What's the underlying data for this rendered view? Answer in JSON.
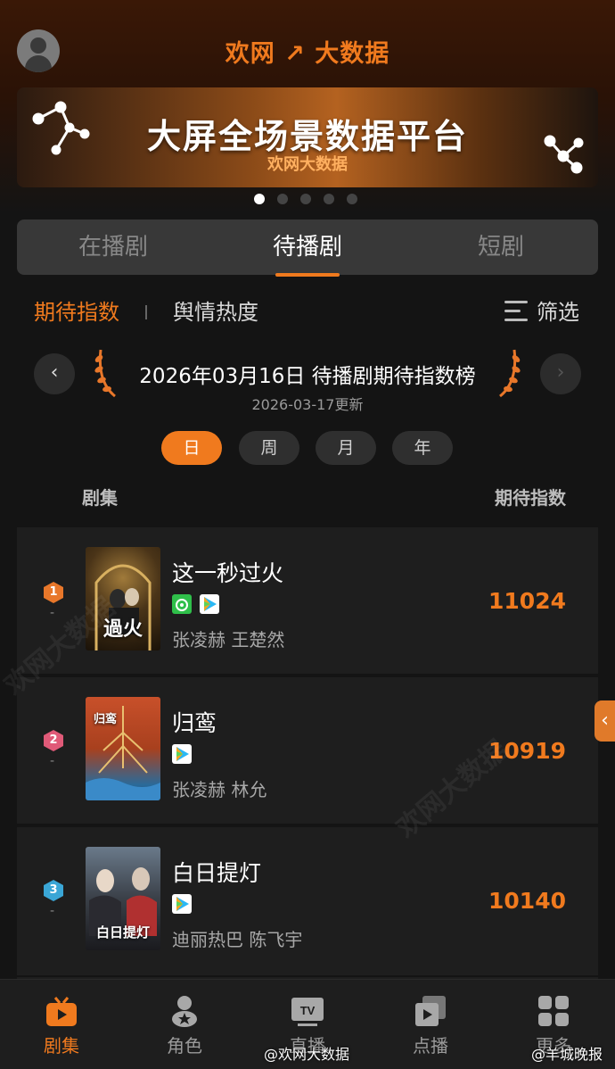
{
  "header": {
    "logo_text": "欢网 ↗ 大数据"
  },
  "banner": {
    "title": "大屏全场景数据平台",
    "subtitle": "欢网大数据",
    "dot_count": 5,
    "active_dot": 0
  },
  "tabs": [
    {
      "label": "在播剧",
      "active": false
    },
    {
      "label": "待播剧",
      "active": true
    },
    {
      "label": "短剧",
      "active": false
    }
  ],
  "subtabs": {
    "active": "期待指数",
    "inactive": "舆情热度",
    "filter_label": "筛选"
  },
  "board": {
    "title": "2026年03月16日 待播剧期待指数榜",
    "updated": "2026-03-17更新",
    "prev_icon": "‹",
    "next_icon": "›"
  },
  "periods": [
    {
      "label": "日",
      "active": true
    },
    {
      "label": "周",
      "active": false
    },
    {
      "label": "月",
      "active": false
    },
    {
      "label": "年",
      "active": false
    }
  ],
  "columns": {
    "left": "剧集",
    "right": "期待指数"
  },
  "rows": [
    {
      "rank": "1",
      "change": "-",
      "title": "这一秒过火",
      "cast": "张凌赫 王楚然",
      "score": "11024",
      "poster_text": "過火",
      "badge_color": "#e8772a",
      "platforms": [
        "iqiyi-icon",
        "tencent-video-icon"
      ]
    },
    {
      "rank": "2",
      "change": "-",
      "title": "归鸾",
      "cast": "张凌赫 林允",
      "score": "10919",
      "poster_text": "归鸾",
      "badge_color": "#e05a78",
      "platforms": [
        "tencent-video-icon"
      ]
    },
    {
      "rank": "3",
      "change": "-",
      "title": "白日提灯",
      "cast": "迪丽热巴 陈飞宇",
      "score": "10140",
      "poster_text": "白日提灯",
      "badge_color": "#3aa6d6",
      "platforms": [
        "tencent-video-icon"
      ]
    }
  ],
  "side_tab": {
    "icon": "‹"
  },
  "watermark": "欢网大数据",
  "bottom_nav": [
    {
      "label": "剧集",
      "icon": "tv-icon",
      "active": true
    },
    {
      "label": "角色",
      "icon": "role-icon",
      "active": false
    },
    {
      "label": "直播",
      "icon": "live-tv-icon",
      "active": false
    },
    {
      "label": "点播",
      "icon": "vod-icon",
      "active": false
    },
    {
      "label": "更多",
      "icon": "grid-icon",
      "active": false
    }
  ],
  "overlay_marks": {
    "left": "@欢网大数据",
    "right": "@羊城晚报"
  },
  "colors": {
    "accent": "#f07a1e",
    "background": "#141414",
    "card": "#1e1e1e"
  }
}
